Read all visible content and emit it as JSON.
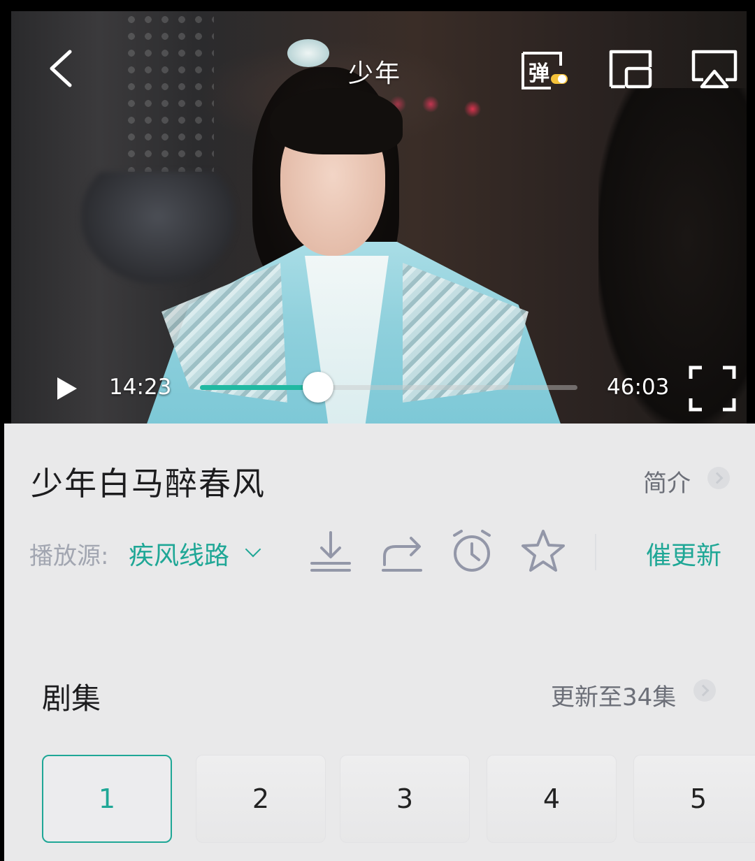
{
  "player": {
    "title": "少年",
    "danmu_label": "弹",
    "current_time": "14:23",
    "total_time": "46:03",
    "progress": 0.3125,
    "accent": "#21b9a2"
  },
  "details": {
    "show_title": "少年白马醉春风",
    "intro_label": "简介",
    "source_label": "播放源:",
    "source_value": "疾风线路",
    "urge_label": "催更新",
    "accent": "#1fa796"
  },
  "actions": [
    "download-icon",
    "share-icon",
    "alarm-icon",
    "favorite-star-icon"
  ],
  "episodes": {
    "title": "剧集",
    "update_text": "更新至34集",
    "items": [
      "1",
      "2",
      "3",
      "4",
      "5"
    ],
    "selected": "1"
  }
}
